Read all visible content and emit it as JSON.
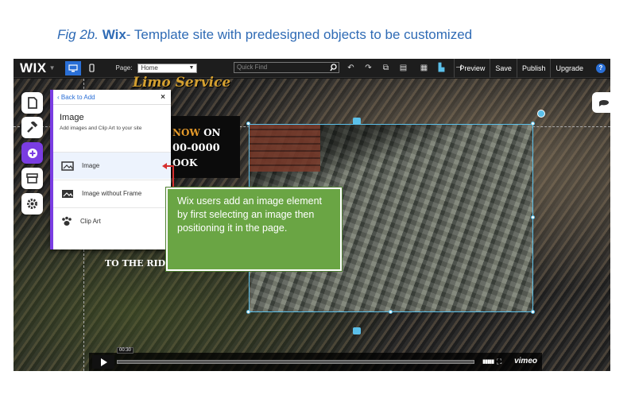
{
  "caption": {
    "fig": "Fig 2b.",
    "brand": "Wix",
    "text": "- Template site with predesigned objects to be customized"
  },
  "topbar": {
    "logo": "WIX",
    "page_label": "Page:",
    "page_value": "Home",
    "quickfind_placeholder": "Quick Find",
    "actions": [
      "Preview",
      "Save",
      "Publish",
      "Upgrade"
    ],
    "help": "?"
  },
  "site": {
    "brand_title": "Limo Service",
    "call_now": "NOW",
    "call_on": " ON",
    "phone": "00-0000",
    "book": "OOK",
    "ride": "TO THE RIDE"
  },
  "add_panel": {
    "back": "Back to Add",
    "close": "×",
    "title": "Image",
    "description": "Add images and Clip Art to your site",
    "items": [
      {
        "label": "Image",
        "icon": "image-icon"
      },
      {
        "label": "Image without Frame",
        "icon": "image-no-frame-icon"
      },
      {
        "label": "Clip Art",
        "icon": "clip-art-paw-icon"
      }
    ]
  },
  "annotation": {
    "text": "Wix users add an image element by first selecting an image then positioning it in the page."
  },
  "video": {
    "time": "00:30",
    "brand": "vimeo",
    "progress": 0.0
  },
  "colors": {
    "caption": "#2f6bb5",
    "accent_purple": "#7a3de2",
    "selection": "#5bc0ea",
    "annotation_green": "#6aa544",
    "arrow_red": "#d62f2f",
    "brand_gold": "#d4a030"
  }
}
